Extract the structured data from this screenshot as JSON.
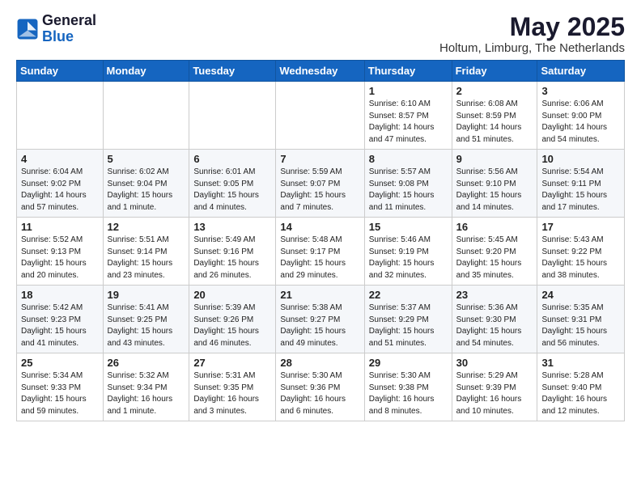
{
  "logo": {
    "text1": "General",
    "text2": "Blue"
  },
  "title": "May 2025",
  "subtitle": "Holtum, Limburg, The Netherlands",
  "days_of_week": [
    "Sunday",
    "Monday",
    "Tuesday",
    "Wednesday",
    "Thursday",
    "Friday",
    "Saturday"
  ],
  "weeks": [
    [
      {
        "day": "",
        "info": ""
      },
      {
        "day": "",
        "info": ""
      },
      {
        "day": "",
        "info": ""
      },
      {
        "day": "",
        "info": ""
      },
      {
        "day": "1",
        "info": "Sunrise: 6:10 AM\nSunset: 8:57 PM\nDaylight: 14 hours\nand 47 minutes."
      },
      {
        "day": "2",
        "info": "Sunrise: 6:08 AM\nSunset: 8:59 PM\nDaylight: 14 hours\nand 51 minutes."
      },
      {
        "day": "3",
        "info": "Sunrise: 6:06 AM\nSunset: 9:00 PM\nDaylight: 14 hours\nand 54 minutes."
      }
    ],
    [
      {
        "day": "4",
        "info": "Sunrise: 6:04 AM\nSunset: 9:02 PM\nDaylight: 14 hours\nand 57 minutes."
      },
      {
        "day": "5",
        "info": "Sunrise: 6:02 AM\nSunset: 9:04 PM\nDaylight: 15 hours\nand 1 minute."
      },
      {
        "day": "6",
        "info": "Sunrise: 6:01 AM\nSunset: 9:05 PM\nDaylight: 15 hours\nand 4 minutes."
      },
      {
        "day": "7",
        "info": "Sunrise: 5:59 AM\nSunset: 9:07 PM\nDaylight: 15 hours\nand 7 minutes."
      },
      {
        "day": "8",
        "info": "Sunrise: 5:57 AM\nSunset: 9:08 PM\nDaylight: 15 hours\nand 11 minutes."
      },
      {
        "day": "9",
        "info": "Sunrise: 5:56 AM\nSunset: 9:10 PM\nDaylight: 15 hours\nand 14 minutes."
      },
      {
        "day": "10",
        "info": "Sunrise: 5:54 AM\nSunset: 9:11 PM\nDaylight: 15 hours\nand 17 minutes."
      }
    ],
    [
      {
        "day": "11",
        "info": "Sunrise: 5:52 AM\nSunset: 9:13 PM\nDaylight: 15 hours\nand 20 minutes."
      },
      {
        "day": "12",
        "info": "Sunrise: 5:51 AM\nSunset: 9:14 PM\nDaylight: 15 hours\nand 23 minutes."
      },
      {
        "day": "13",
        "info": "Sunrise: 5:49 AM\nSunset: 9:16 PM\nDaylight: 15 hours\nand 26 minutes."
      },
      {
        "day": "14",
        "info": "Sunrise: 5:48 AM\nSunset: 9:17 PM\nDaylight: 15 hours\nand 29 minutes."
      },
      {
        "day": "15",
        "info": "Sunrise: 5:46 AM\nSunset: 9:19 PM\nDaylight: 15 hours\nand 32 minutes."
      },
      {
        "day": "16",
        "info": "Sunrise: 5:45 AM\nSunset: 9:20 PM\nDaylight: 15 hours\nand 35 minutes."
      },
      {
        "day": "17",
        "info": "Sunrise: 5:43 AM\nSunset: 9:22 PM\nDaylight: 15 hours\nand 38 minutes."
      }
    ],
    [
      {
        "day": "18",
        "info": "Sunrise: 5:42 AM\nSunset: 9:23 PM\nDaylight: 15 hours\nand 41 minutes."
      },
      {
        "day": "19",
        "info": "Sunrise: 5:41 AM\nSunset: 9:25 PM\nDaylight: 15 hours\nand 43 minutes."
      },
      {
        "day": "20",
        "info": "Sunrise: 5:39 AM\nSunset: 9:26 PM\nDaylight: 15 hours\nand 46 minutes."
      },
      {
        "day": "21",
        "info": "Sunrise: 5:38 AM\nSunset: 9:27 PM\nDaylight: 15 hours\nand 49 minutes."
      },
      {
        "day": "22",
        "info": "Sunrise: 5:37 AM\nSunset: 9:29 PM\nDaylight: 15 hours\nand 51 minutes."
      },
      {
        "day": "23",
        "info": "Sunrise: 5:36 AM\nSunset: 9:30 PM\nDaylight: 15 hours\nand 54 minutes."
      },
      {
        "day": "24",
        "info": "Sunrise: 5:35 AM\nSunset: 9:31 PM\nDaylight: 15 hours\nand 56 minutes."
      }
    ],
    [
      {
        "day": "25",
        "info": "Sunrise: 5:34 AM\nSunset: 9:33 PM\nDaylight: 15 hours\nand 59 minutes."
      },
      {
        "day": "26",
        "info": "Sunrise: 5:32 AM\nSunset: 9:34 PM\nDaylight: 16 hours\nand 1 minute."
      },
      {
        "day": "27",
        "info": "Sunrise: 5:31 AM\nSunset: 9:35 PM\nDaylight: 16 hours\nand 3 minutes."
      },
      {
        "day": "28",
        "info": "Sunrise: 5:30 AM\nSunset: 9:36 PM\nDaylight: 16 hours\nand 6 minutes."
      },
      {
        "day": "29",
        "info": "Sunrise: 5:30 AM\nSunset: 9:38 PM\nDaylight: 16 hours\nand 8 minutes."
      },
      {
        "day": "30",
        "info": "Sunrise: 5:29 AM\nSunset: 9:39 PM\nDaylight: 16 hours\nand 10 minutes."
      },
      {
        "day": "31",
        "info": "Sunrise: 5:28 AM\nSunset: 9:40 PM\nDaylight: 16 hours\nand 12 minutes."
      }
    ]
  ]
}
